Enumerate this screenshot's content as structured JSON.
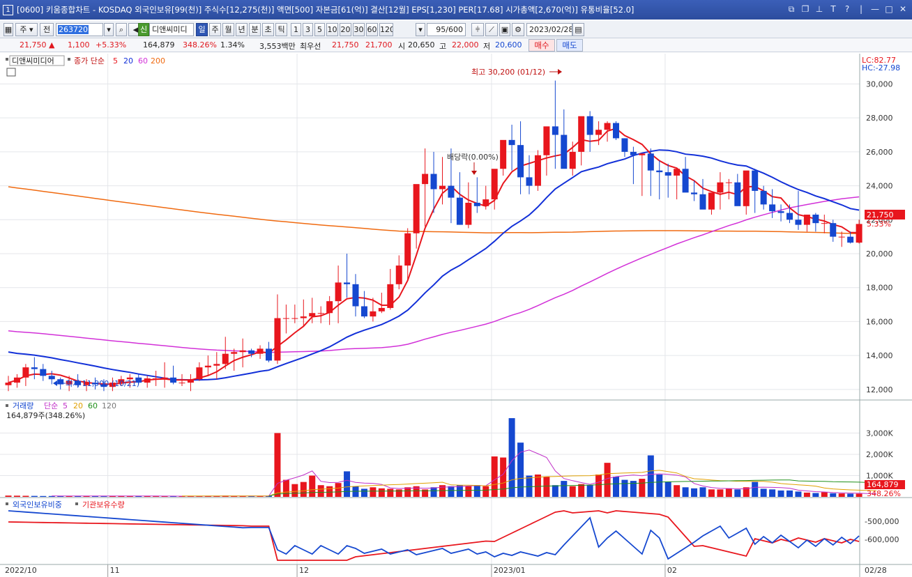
{
  "title": {
    "index": "1",
    "text": "[0600] 키움종합차트 - KOSDAQ 외국인보유[99(천)] 주식수[12,275(천)] 액면[500] 자본금[61(억)] 결산[12월] EPS[1,230] PER[17.68] 시가총액[2,670(억)] 유통비율[52.0]"
  },
  "toolbar": {
    "market": "주",
    "prev": "전",
    "code": "263720",
    "stock_name": "디앤씨미디",
    "stock_flag": "신",
    "periods": [
      "일",
      "주",
      "월",
      "년",
      "분",
      "초",
      "틱"
    ],
    "active_period": "일",
    "intervals": [
      "1",
      "3",
      "5",
      "10",
      "20",
      "30",
      "60",
      "120"
    ],
    "count": "95/600",
    "date": "2023/02/28"
  },
  "quote": {
    "price": "21,750",
    "arrow": "▲",
    "change": "1,100",
    "change_pct": "+5.33%",
    "volume": "164,879",
    "vol_ratio": "348.26%",
    "turnover": "1.34%",
    "amount": "3,553백만",
    "best_label": "최우선",
    "best_ask": "21,750",
    "best_bid": "21,700",
    "open_label": "시",
    "open": "20,650",
    "high_label": "고",
    "high": "22,000",
    "low_label": "저",
    "low": "20,600",
    "buy_label": "매수",
    "sell_label": "매도"
  },
  "price_panel": {
    "stock_label": "디앤씨미디어",
    "ma_label": "종가 단순",
    "ma_periods": [
      "5",
      "20",
      "60",
      "200"
    ],
    "lc": "LC:82.77",
    "hc": "HC:-27.98",
    "max_label": "최고 30,200 (01/12)",
    "min_label": "최저 11,900 (10/21)",
    "dividend_label": "배당락(0.00%)",
    "current_tag": "21,750",
    "current_pct": "5.33%",
    "ticks": [
      "12,000",
      "14,000",
      "16,000",
      "18,000",
      "20,000",
      "22,000",
      "24,000",
      "26,000",
      "28,000",
      "30,000"
    ]
  },
  "volume_panel": {
    "label": "거래량",
    "ma_label": "단순",
    "ma_periods": [
      "5",
      "20",
      "60",
      "120"
    ],
    "value_text": "164,879주(348.26%)",
    "ticks": [
      "1,000K",
      "2,000K",
      "3,000K"
    ],
    "current_tag": "164,879",
    "current_pct": "348.26%"
  },
  "foreign_panel": {
    "label1": "외국인보유비중",
    "label2": "기관보유수량",
    "ticks": [
      "-500,000",
      "-600,000"
    ]
  },
  "x_axis": {
    "labels": [
      "2022/10",
      "11",
      "12",
      "2023/01",
      "02",
      "02/28"
    ]
  },
  "colors": {
    "up": "#e8161d",
    "down": "#1548d0",
    "ma5": "#e8161d",
    "ma20": "#1230d8",
    "ma60": "#d230d8",
    "ma200": "#f06a10"
  },
  "chart_data": {
    "type": "candlestick",
    "x": [
      "10/04",
      "10/05",
      "10/06",
      "10/07",
      "10/11",
      "10/12",
      "10/13",
      "10/14",
      "10/17",
      "10/18",
      "10/19",
      "10/20",
      "10/21",
      "10/24",
      "10/25",
      "10/26",
      "10/27",
      "10/28",
      "10/31",
      "11/01",
      "11/02",
      "11/03",
      "11/04",
      "11/07",
      "11/08",
      "11/09",
      "11/10",
      "11/11",
      "11/14",
      "11/15",
      "11/16",
      "11/17",
      "11/18",
      "11/21",
      "11/22",
      "11/23",
      "11/24",
      "11/25",
      "11/28",
      "11/29",
      "11/30",
      "12/01",
      "12/02",
      "12/05",
      "12/06",
      "12/07",
      "12/08",
      "12/09",
      "12/12",
      "12/13",
      "12/14",
      "12/15",
      "12/16",
      "12/19",
      "12/20",
      "12/21",
      "12/22",
      "12/23",
      "12/26",
      "12/27",
      "12/28",
      "01/02",
      "01/03",
      "01/04",
      "01/05",
      "01/06",
      "01/09",
      "01/10",
      "01/11",
      "01/12",
      "01/13",
      "01/16",
      "01/17",
      "01/18",
      "01/19",
      "01/20",
      "01/25",
      "01/26",
      "01/27",
      "01/30",
      "01/31",
      "02/01",
      "02/02",
      "02/03",
      "02/06",
      "02/07",
      "02/08",
      "02/09",
      "02/10",
      "02/13",
      "02/14",
      "02/15",
      "02/16",
      "02/17",
      "02/20",
      "02/21",
      "02/22",
      "02/23",
      "02/24",
      "02/27",
      "02/28"
    ],
    "open": [
      12250,
      12400,
      12700,
      13300,
      13200,
      12800,
      12600,
      12300,
      12500,
      12250,
      12400,
      12300,
      12150,
      12400,
      12600,
      12700,
      12400,
      12650,
      12650,
      12700,
      12400,
      12400,
      12600,
      13300,
      13400,
      13500,
      14100,
      14200,
      14300,
      14100,
      14400,
      13700,
      16200,
      16200,
      16200,
      16300,
      16500,
      16500,
      17200,
      18300,
      18200,
      16900,
      16300,
      16600,
      16800,
      18200,
      19300,
      21200,
      24100,
      24700,
      23800,
      24000,
      23300,
      21700,
      23000,
      22800,
      23200,
      25000,
      26700,
      26400,
      24500,
      24000,
      25800,
      27500,
      27000,
      25000,
      26000,
      28100,
      27000,
      27300,
      27700,
      26800,
      26000,
      25800,
      25900,
      24900,
      24800,
      24600,
      25000,
      23600,
      23500,
      22600,
      23600,
      24200,
      24200,
      22800,
      24900,
      23700,
      22900,
      22500,
      22400,
      22000,
      21700,
      22300,
      21800,
      21800,
      21000,
      21000,
      20650
    ],
    "high": [
      12800,
      12900,
      13500,
      13900,
      13500,
      13100,
      12700,
      12800,
      12900,
      12600,
      12700,
      12600,
      12700,
      12800,
      12900,
      12900,
      12800,
      13100,
      13600,
      13400,
      12900,
      12900,
      13600,
      14000,
      14200,
      15100,
      14400,
      15000,
      14400,
      14600,
      14800,
      17600,
      17000,
      17000,
      17300,
      17400,
      16900,
      17500,
      19300,
      20000,
      18800,
      17800,
      17400,
      17700,
      19100,
      19900,
      21500,
      22900,
      26200,
      26000,
      25700,
      26200,
      24800,
      24200,
      24500,
      24000,
      23600,
      25600,
      27600,
      27800,
      25800,
      26100,
      26400,
      30200,
      28500,
      26600,
      27000,
      28400,
      27800,
      27800,
      27800,
      26800,
      26300,
      25900,
      26200,
      25500,
      25300,
      25000,
      25700,
      24300,
      24400,
      23500,
      24800,
      24400,
      24700,
      23800,
      25000,
      24000,
      23800,
      22900,
      22900,
      23700,
      22200,
      22400,
      22300,
      22000,
      21300,
      21300,
      22000
    ],
    "low": [
      11900,
      12100,
      12200,
      12600,
      12500,
      12300,
      12000,
      11900,
      12100,
      11900,
      12000,
      11900,
      11900,
      12200,
      12100,
      12300,
      12100,
      12200,
      12100,
      12300,
      12200,
      11900,
      12500,
      12800,
      12600,
      13200,
      13100,
      13300,
      13900,
      13800,
      13600,
      13500,
      15300,
      15900,
      15700,
      15900,
      15900,
      15800,
      15900,
      17400,
      16300,
      16200,
      16000,
      16500,
      16700,
      17900,
      18400,
      20300,
      21600,
      22400,
      22900,
      21800,
      21700,
      21500,
      22400,
      22600,
      22600,
      24600,
      24900,
      23500,
      23500,
      23700,
      24600,
      25000,
      25100,
      24600,
      25200,
      26000,
      26400,
      26600,
      26700,
      25700,
      24100,
      23400,
      23400,
      23200,
      23300,
      23200,
      24400,
      23100,
      23100,
      22300,
      22600,
      23200,
      23700,
      22300,
      22400,
      22600,
      22100,
      21900,
      21800,
      21400,
      21300,
      21300,
      21200,
      20700,
      20400,
      20600,
      20600
    ],
    "close": [
      12400,
      12700,
      13300,
      13200,
      12800,
      12600,
      12300,
      12500,
      12250,
      12400,
      12300,
      12150,
      12400,
      12600,
      12700,
      12400,
      12650,
      12650,
      12700,
      12400,
      12400,
      12600,
      13300,
      13400,
      13500,
      14100,
      14200,
      14300,
      14100,
      14400,
      13700,
      16200,
      16200,
      16200,
      16300,
      16500,
      16500,
      17200,
      18300,
      18200,
      16900,
      16300,
      16600,
      16800,
      18200,
      19300,
      21200,
      24100,
      24700,
      23800,
      24000,
      23300,
      21700,
      23000,
      22800,
      23200,
      25000,
      26700,
      26400,
      24500,
      24000,
      25800,
      27500,
      27000,
      25000,
      26000,
      28100,
      27000,
      27300,
      27700,
      26800,
      26000,
      25800,
      25900,
      24900,
      24800,
      24600,
      25000,
      23600,
      23500,
      22600,
      23600,
      24200,
      24200,
      22800,
      24900,
      23700,
      22900,
      22500,
      22400,
      22000,
      21700,
      22300,
      21800,
      21800,
      21000,
      21000,
      20650,
      21750
    ],
    "volume": [
      60,
      55,
      50,
      45,
      40,
      40,
      35,
      45,
      40,
      40,
      35,
      30,
      45,
      50,
      40,
      40,
      35,
      30,
      35,
      40,
      30,
      30,
      35,
      40,
      40,
      60,
      40,
      40,
      35,
      40,
      45,
      3000,
      800,
      600,
      700,
      1000,
      550,
      500,
      650,
      1200,
      500,
      380,
      450,
      400,
      380,
      350,
      450,
      500,
      350,
      450,
      550,
      500,
      550,
      500,
      550,
      500,
      1900,
      1850,
      3700,
      2550,
      1000,
      1050,
      950,
      550,
      750,
      500,
      600,
      550,
      1050,
      1600,
      950,
      800,
      750,
      850,
      1950,
      1050,
      700,
      550,
      450,
      400,
      450,
      350,
      350,
      400,
      350,
      450,
      700,
      380,
      350,
      300,
      300,
      250,
      200,
      180,
      220,
      170,
      160,
      150,
      150,
      140,
      165
    ],
    "ylim": [
      11500,
      30800
    ],
    "series_names": [
      "종가",
      "5",
      "20",
      "60",
      "200"
    ]
  }
}
